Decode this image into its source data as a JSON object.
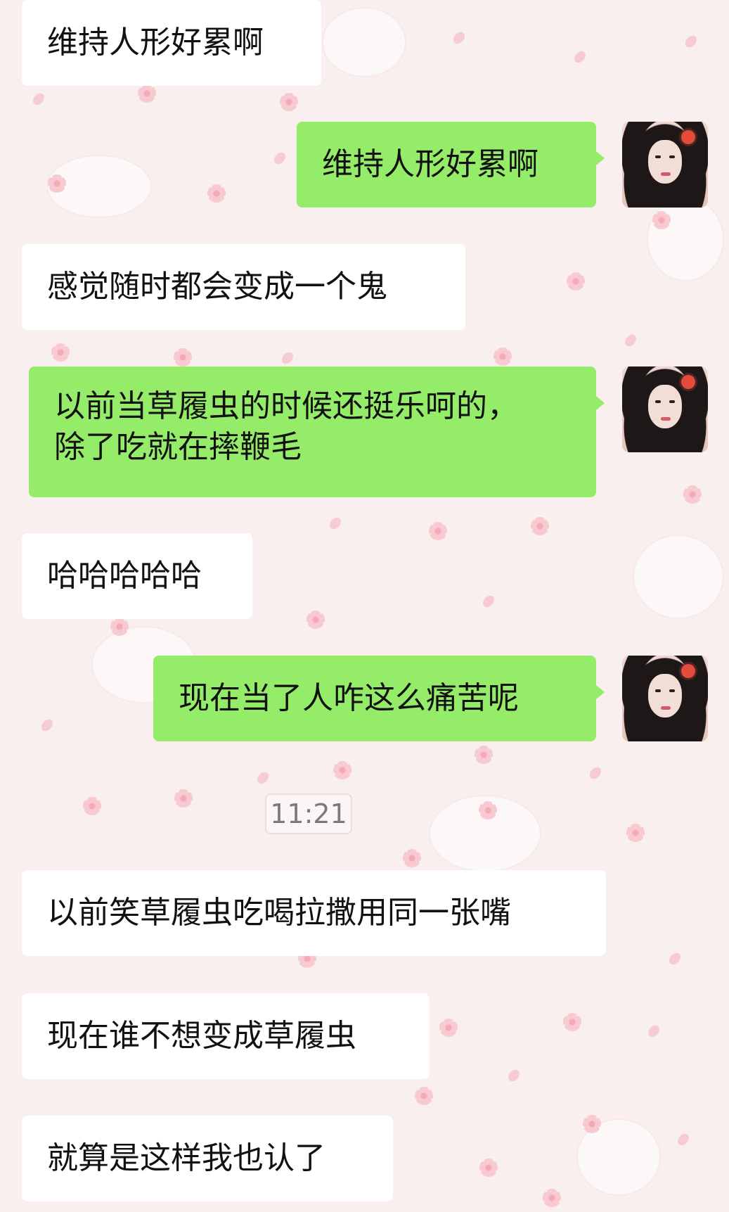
{
  "chat": {
    "messages": [
      {
        "side": "left",
        "text": "维持人形好累啊"
      },
      {
        "side": "right",
        "text": "维持人形好累啊"
      },
      {
        "side": "left",
        "text": "感觉随时都会变成一个鬼"
      },
      {
        "side": "right",
        "text": "以前当草履虫的时候还挺乐呵的，\n除了吃就在摔鞭毛"
      },
      {
        "side": "left",
        "text": "哈哈哈哈哈"
      },
      {
        "side": "right",
        "text": "现在当了人咋这么痛苦呢"
      },
      {
        "side": "left",
        "text": "以前笑草履虫吃喝拉撒用同一张嘴"
      },
      {
        "side": "left",
        "text": "现在谁不想变成草履虫"
      },
      {
        "side": "left",
        "text": "就算是这样我也认了"
      }
    ],
    "timestamp": "11:21"
  },
  "colors": {
    "background": "#f8efee",
    "left_bubble": "#ffffff",
    "right_bubble": "#95ec69",
    "text": "#111111"
  },
  "icons": {
    "avatar": "avatar-icon",
    "decor_flower": "flower-icon",
    "decor_petal": "petal-icon"
  }
}
